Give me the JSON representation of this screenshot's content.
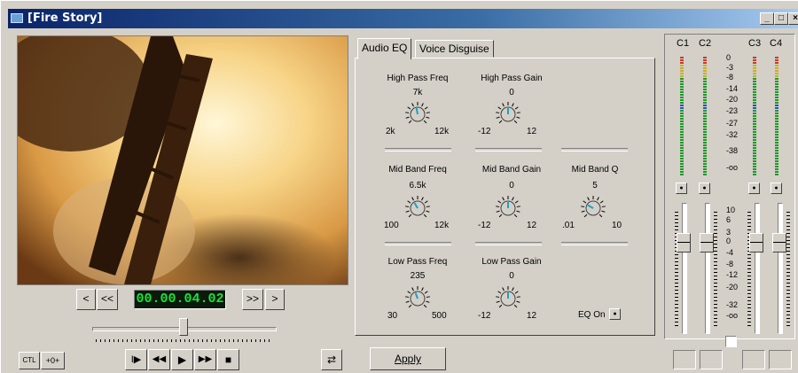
{
  "window": {
    "title": "[Fire Story]"
  },
  "transport": {
    "timecode": "00.00.04.02",
    "prev_label": "<",
    "rewind_label": "<<",
    "ffwd_label": ">>",
    "next_label": ">",
    "ctl_label": "CTL",
    "zero_label": "+0+",
    "play_mark_label": "I▶",
    "rew_label": "◀◀",
    "play_label": "▶",
    "ff_label": "▶▶",
    "stop_label": "■",
    "loop_icon": "loop-icon",
    "shuttle_position": 0.5
  },
  "tabs": [
    {
      "label": "Audio EQ",
      "active": true
    },
    {
      "label": "Voice Disguise",
      "active": false
    }
  ],
  "eq": {
    "high_pass_freq": {
      "label": "High Pass Freq",
      "value": "7k",
      "min": "2k",
      "max": "12k"
    },
    "high_pass_gain": {
      "label": "High Pass Gain",
      "value": "0",
      "min": "-12",
      "max": "12"
    },
    "mid_band_freq": {
      "label": "Mid Band Freq",
      "value": "6.5k",
      "min": "100",
      "max": "12k"
    },
    "mid_band_gain": {
      "label": "Mid Band Gain",
      "value": "0",
      "min": "-12",
      "max": "12"
    },
    "mid_band_q": {
      "label": "Mid Band Q",
      "value": "5",
      "min": ".01",
      "max": "10"
    },
    "low_pass_freq": {
      "label": "Low Pass Freq",
      "value": "235",
      "min": "30",
      "max": "500"
    },
    "low_pass_gain": {
      "label": "Low Pass Gain",
      "value": "0",
      "min": "-12",
      "max": "12"
    },
    "eq_on_label": "EQ On",
    "apply_label": "Apply"
  },
  "meters": {
    "channels": [
      "C1",
      "C2",
      "C3",
      "C4"
    ],
    "scale": [
      "0",
      "-3",
      "-8",
      "-14",
      "-20",
      "-23",
      "-27",
      "-32",
      "-38",
      "-oo"
    ],
    "fader_scale": [
      "10",
      "6",
      "3",
      "0",
      "-4",
      "-8",
      "-12",
      "-20",
      "-32",
      "-oo"
    ]
  },
  "colors": {
    "timecode": "#19e23a",
    "title_start": "#0a246a"
  }
}
